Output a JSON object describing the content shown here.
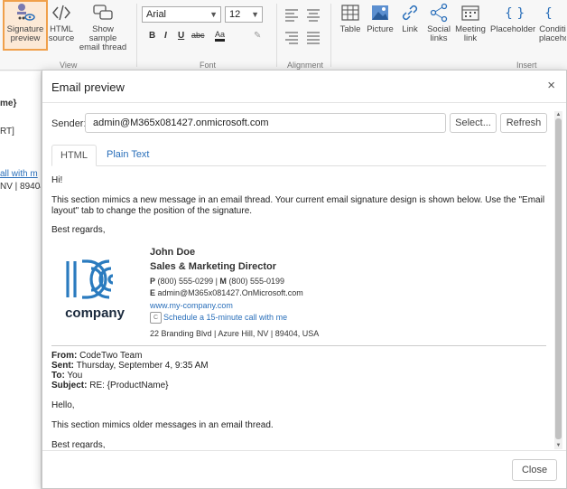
{
  "ribbon": {
    "signature_preview": "Signature preview",
    "html_source": "HTML source",
    "show_sample": "Show sample email thread",
    "view_label": "View",
    "font_family": "Arial",
    "font_size": "12",
    "bold": "B",
    "italic": "I",
    "underline": "U",
    "strike": "abc",
    "font_label": "Font",
    "alignment_label": "Alignment",
    "table": "Table",
    "picture": "Picture",
    "link": "Link",
    "social_links": "Social links",
    "meeting_link": "Meeting link",
    "placeholder": "Placeholder",
    "conditional": "Conditi placeho",
    "insert_label": "Insert"
  },
  "bg_editor": {
    "line1": "me}",
    "line2": "RT]",
    "line3": "all with m",
    "line4": "NV | 89404"
  },
  "dialog": {
    "title": "Email preview",
    "close_glyph": "×",
    "sender_label": "Sender:",
    "sender_value": "admin@M365x081427.onmicrosoft.com",
    "select_button": "Select...",
    "refresh_button": "Refresh",
    "tab_html": "HTML",
    "tab_plain": "Plain Text",
    "close_button": "Close"
  },
  "email": {
    "greeting": "Hi!",
    "intro": "This section mimics a new message in an email thread. Your current email signature design is shown below. Use the \"Email layout\" tab to change the position of the signature.",
    "regards": "Best regards,",
    "logo_text": "company",
    "sig_name": "John Doe",
    "sig_role": "Sales & Marketing Director",
    "phone_label": "P",
    "phone": "(800) 555-0299",
    "mobile_label": "M",
    "mobile": "(800) 555-0199",
    "email_label": "E",
    "email": "admin@M365x081427.OnMicrosoft.com",
    "website": "www.my-company.com",
    "schedule": "Schedule a 15-minute call with me",
    "address": "22 Branding Blvd | Azure Hill, NV | 89404, USA",
    "from_label": "From:",
    "from": "CodeTwo Team",
    "sent_label": "Sent:",
    "sent": "Thursday, September 4, 9:35 AM",
    "to_label": "To:",
    "to": "You",
    "subject_label": "Subject:",
    "subject": "RE: {ProductName}",
    "hello": "Hello,",
    "older": "This section mimics older messages in an email thread.",
    "regards2": "Best regards,"
  },
  "colors": {
    "accent": "#2a6fba",
    "logo_blue": "#2a7bbf",
    "selected_outline": "#f0a04b"
  }
}
